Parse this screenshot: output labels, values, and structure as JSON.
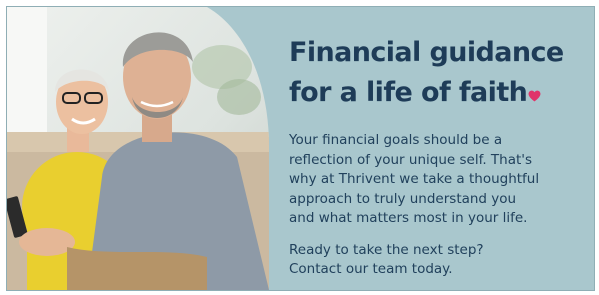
{
  "headline": {
    "line1": "Financial guidance",
    "line2": "for a life of faith"
  },
  "body": {
    "lines": [
      "Your financial goals should be a",
      "reflection of your unique self. That's",
      "why at Thrivent we take a thoughtful",
      "approach to truly understand you",
      "and what matters most in your life."
    ]
  },
  "cta": {
    "lines": [
      "Ready to take the next step?",
      "Contact our team today."
    ]
  },
  "colors": {
    "panel_background": "#a9c7cd",
    "headline": "#1e3c58",
    "body_text": "#21415c",
    "heart_accent": "#e0356a"
  },
  "icons": {
    "heart": "heart-icon"
  }
}
